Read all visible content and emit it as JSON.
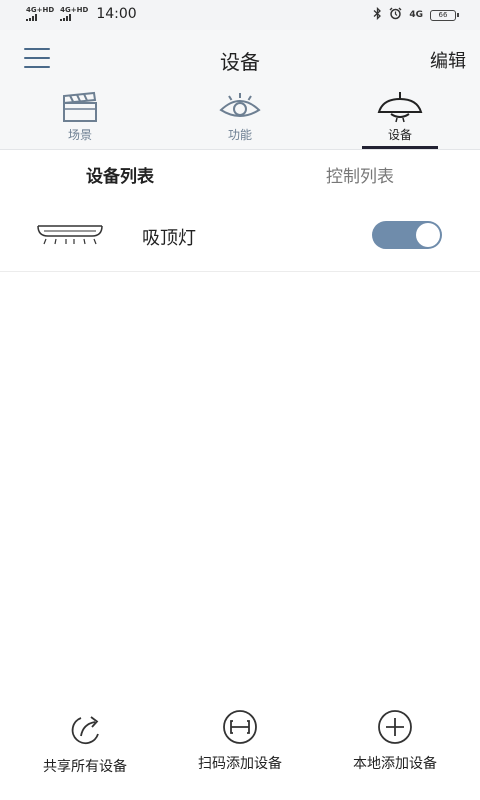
{
  "status_bar": {
    "sim1_label": "4G+HD",
    "sim2_label": "4G+HD",
    "time": "14:00",
    "network": "4G",
    "battery": "66",
    "icons": [
      "bluetooth-icon",
      "alarm-icon"
    ]
  },
  "header": {
    "title": "设备",
    "edit_label": "编辑"
  },
  "main_tabs": [
    {
      "label": "场景",
      "icon": "clapperboard-icon",
      "active": false
    },
    {
      "label": "功能",
      "icon": "eye-icon",
      "active": false
    },
    {
      "label": "设备",
      "icon": "pendant-lamp-icon",
      "active": true
    }
  ],
  "sub_tabs": [
    {
      "label": "设备列表",
      "active": true
    },
    {
      "label": "控制列表",
      "active": false
    }
  ],
  "devices": [
    {
      "name": "吸顶灯",
      "icon": "ceiling-light-icon",
      "on": true
    }
  ],
  "bottom_actions": [
    {
      "label": "共享所有设备",
      "icon": "share-icon"
    },
    {
      "label": "扫码添加设备",
      "icon": "scan-icon"
    },
    {
      "label": "本地添加设备",
      "icon": "add-circle-icon"
    }
  ],
  "colors": {
    "accent": "#6f8cab",
    "header_bg": "#f6f7f8",
    "inactive_tab": "#6d7f92"
  }
}
